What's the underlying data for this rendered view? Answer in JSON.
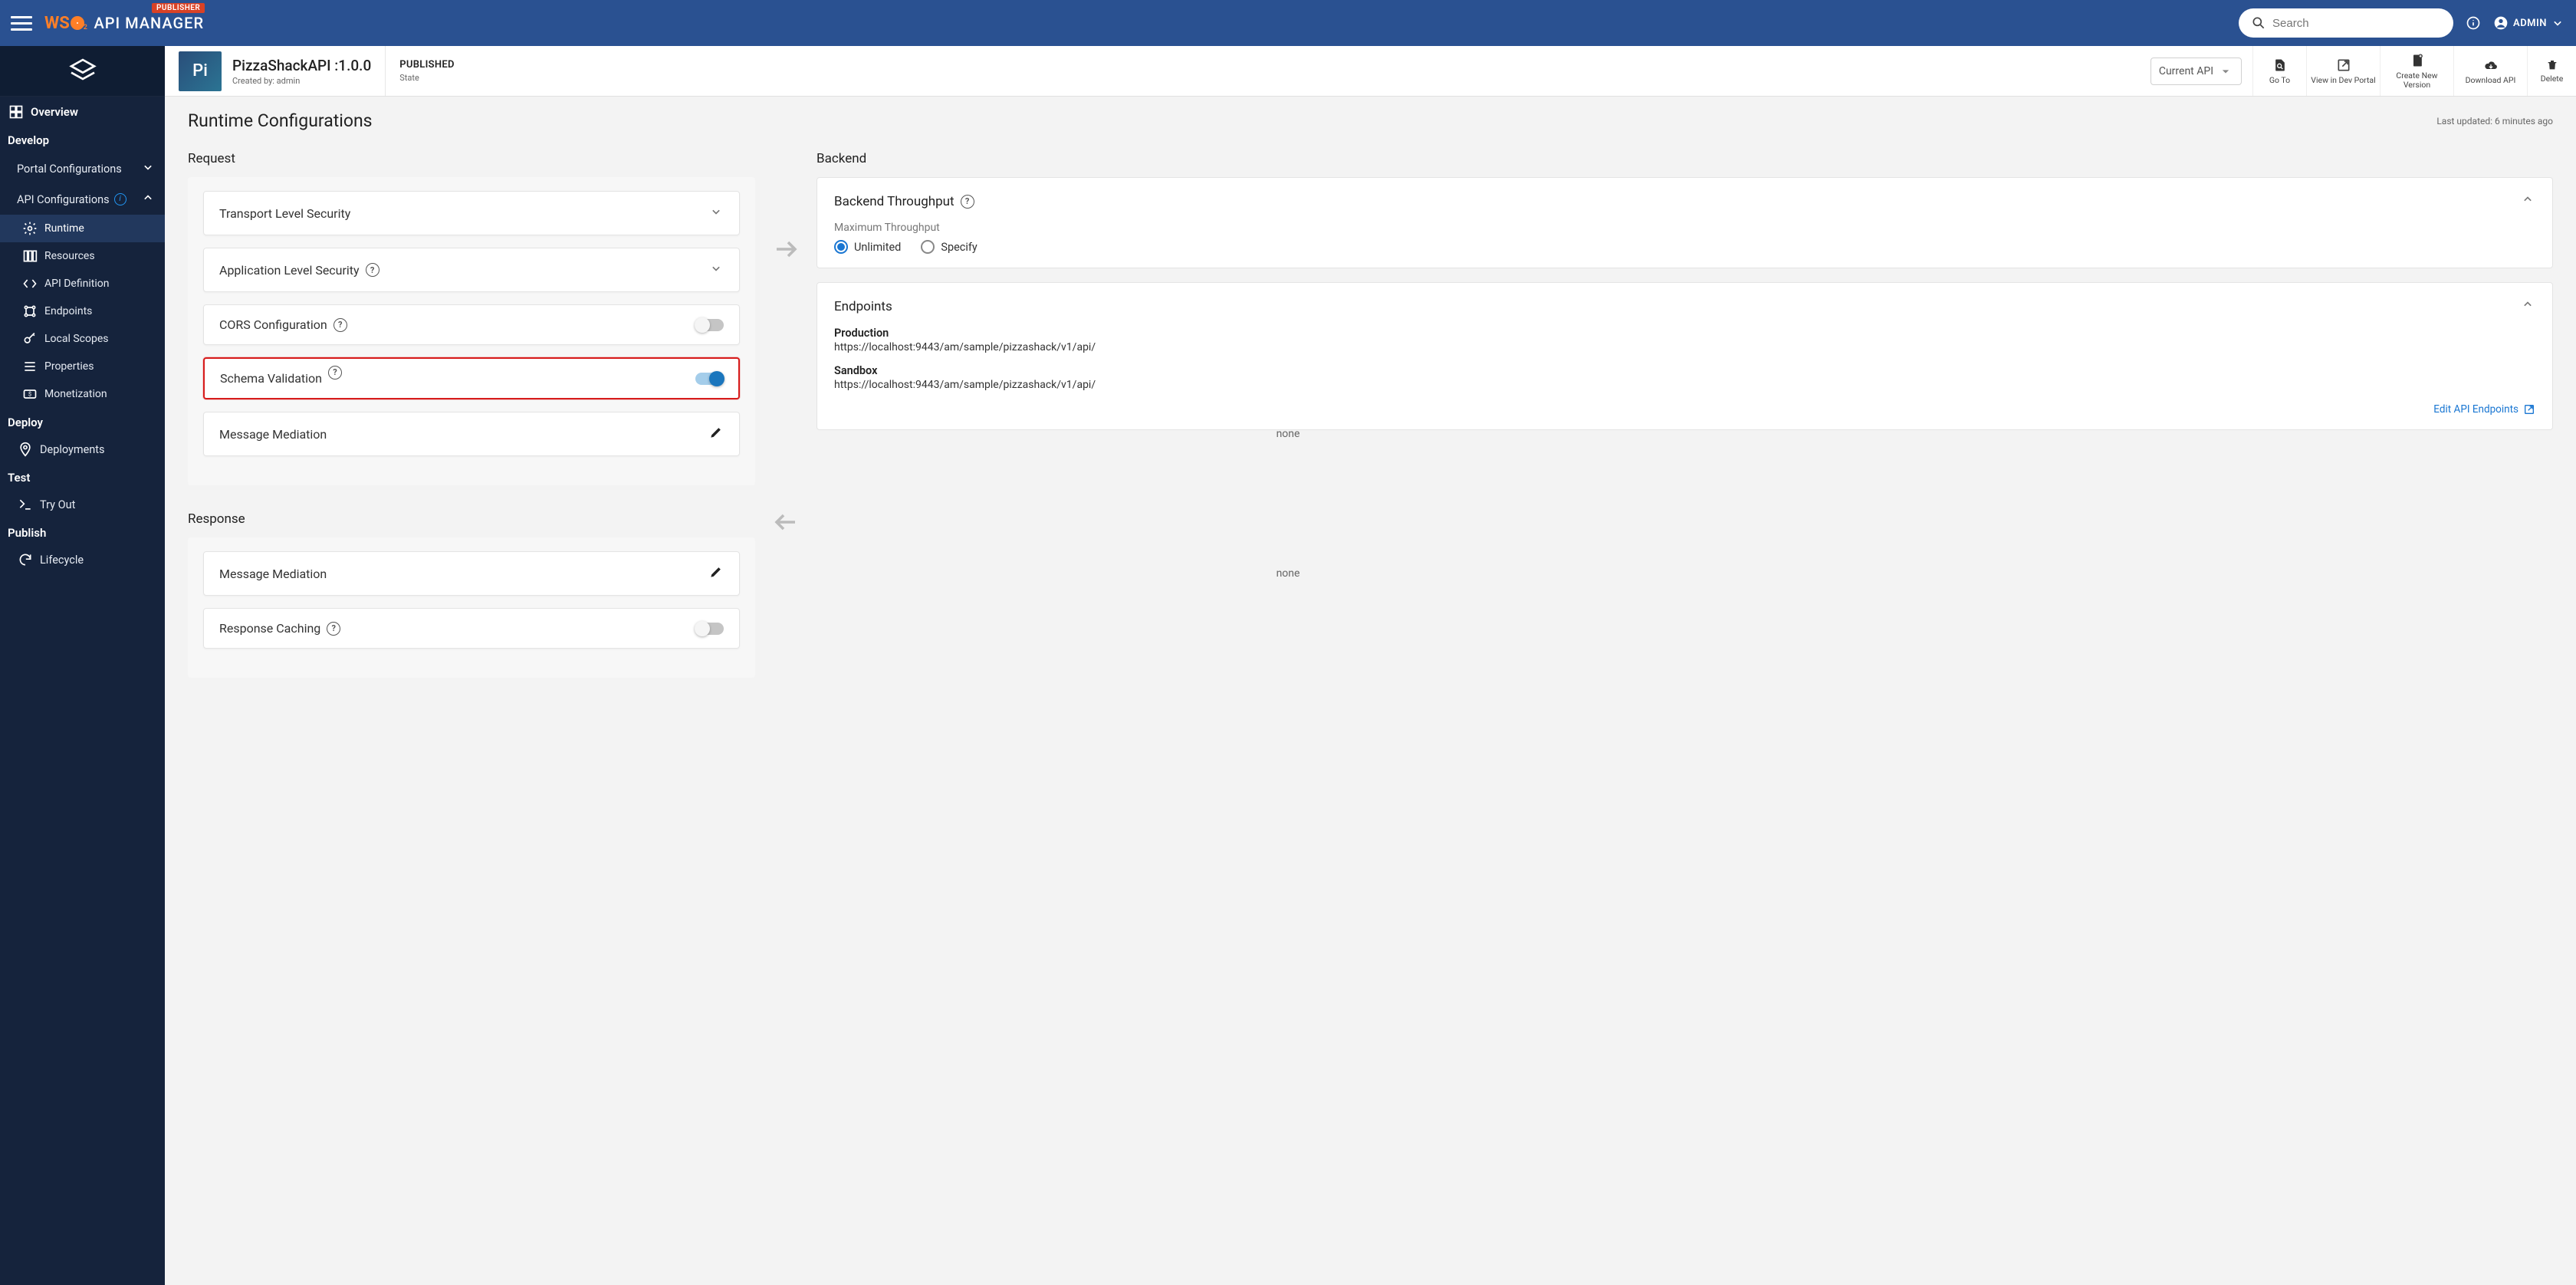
{
  "app": {
    "publisher_badge": "PUBLISHER",
    "logo_ws": "WS",
    "logo_sub": "2",
    "logo_apimgr": "API MANAGER"
  },
  "topbar": {
    "search_placeholder": "Search",
    "admin_label": "ADMIN"
  },
  "sidebar": {
    "overview": "Overview",
    "develop": "Develop",
    "portal_configs": "Portal Configurations",
    "api_configs": "API Configurations",
    "runtime": "Runtime",
    "resources": "Resources",
    "api_definition": "API Definition",
    "endpoints": "Endpoints",
    "local_scopes": "Local Scopes",
    "properties": "Properties",
    "monetization": "Monetization",
    "deploy": "Deploy",
    "deployments": "Deployments",
    "test": "Test",
    "tryout": "Try Out",
    "publish": "Publish",
    "lifecycle": "Lifecycle"
  },
  "api_header": {
    "avatar": "Pi",
    "title": "PizzaShackAPI :1.0.0",
    "created_by": "Created by: admin",
    "state_value": "PUBLISHED",
    "state_label": "State",
    "dropdown": "Current API",
    "actions": {
      "goto": "Go To",
      "view_dev": "View in Dev Portal",
      "create_new": "Create New Version",
      "download": "Download API",
      "delete": "Delete"
    }
  },
  "page": {
    "title": "Runtime Configurations",
    "last_updated": "Last updated: 6 minutes ago",
    "request_label": "Request",
    "response_label": "Response",
    "backend_label": "Backend"
  },
  "request": {
    "transport_sec": "Transport Level Security",
    "app_sec": "Application Level Security",
    "cors": "CORS Configuration",
    "schema_validation": "Schema Validation",
    "msg_mediation": "Message Mediation",
    "msg_mediation_val": "none"
  },
  "response": {
    "msg_mediation": "Message Mediation",
    "msg_mediation_val": "none",
    "resp_caching": "Response Caching"
  },
  "backend": {
    "throughput_title": "Backend Throughput",
    "max_throughput": "Maximum Throughput",
    "radio_unlimited": "Unlimited",
    "radio_specify": "Specify",
    "endpoints_title": "Endpoints",
    "production_label": "Production",
    "production_url": "https://localhost:9443/am/sample/pizzashack/v1/api/",
    "sandbox_label": "Sandbox",
    "sandbox_url": "https://localhost:9443/am/sample/pizzashack/v1/api/",
    "edit_link": "Edit API Endpoints"
  }
}
